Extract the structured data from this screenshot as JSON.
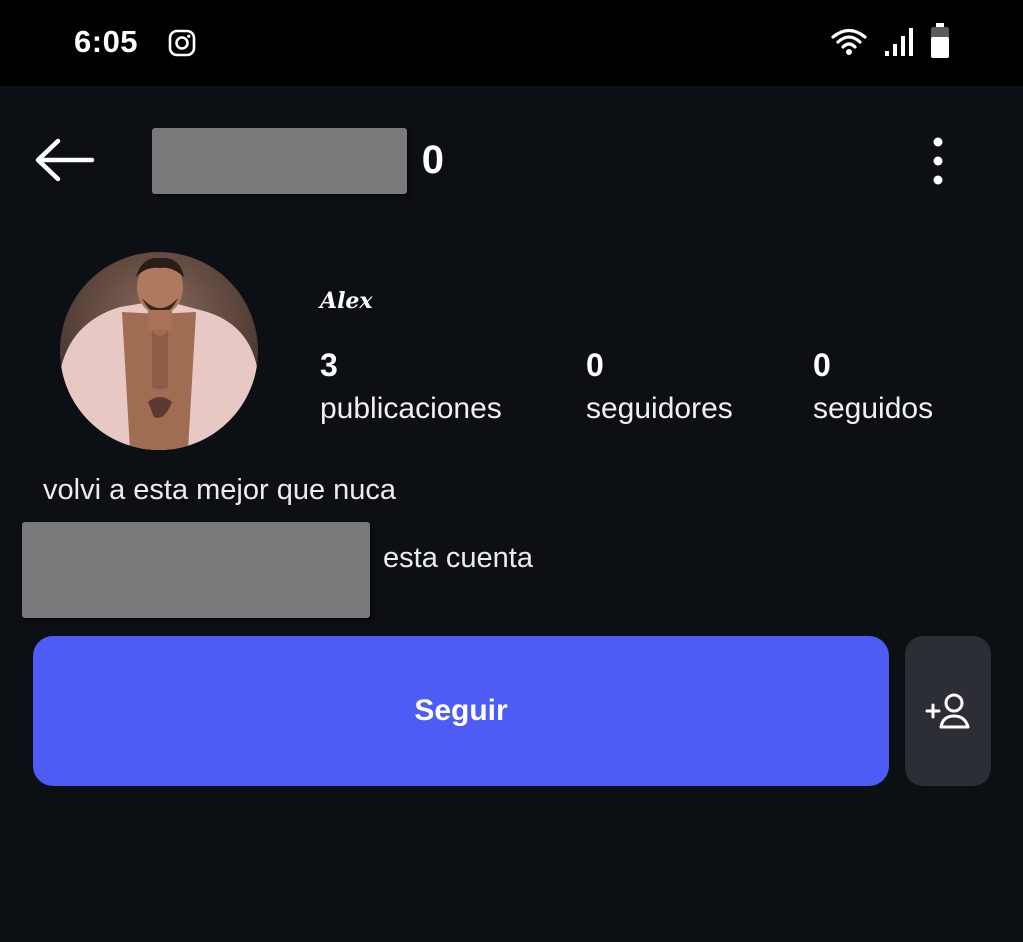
{
  "status_bar": {
    "time": "6:05",
    "notification_icon": "instagram-icon",
    "right_icons": [
      "wifi-icon",
      "signal-icon",
      "battery-icon"
    ]
  },
  "header": {
    "back_icon": "arrow-left-icon",
    "username": "0",
    "username_redacted": true,
    "more_icon": "more-vertical-icon"
  },
  "profile": {
    "display_name": "Alex",
    "stats": [
      {
        "value": "3",
        "label": "publicaciones"
      },
      {
        "value": "0",
        "label": "seguidores"
      },
      {
        "value": "0",
        "label": "seguidos"
      }
    ],
    "bio": "volvi a esta mejor que nuca",
    "context_line_visible": "esta cuenta",
    "context_line_redacted": true
  },
  "actions": {
    "follow_label": "Seguir",
    "suggest_icon": "add-person-icon"
  },
  "colors": {
    "background": "#0c0f14",
    "status_bar": "#000000",
    "follow_button": "#4d5cf5",
    "secondary_button": "#2b2e35",
    "redaction": "#7a7a7c"
  }
}
